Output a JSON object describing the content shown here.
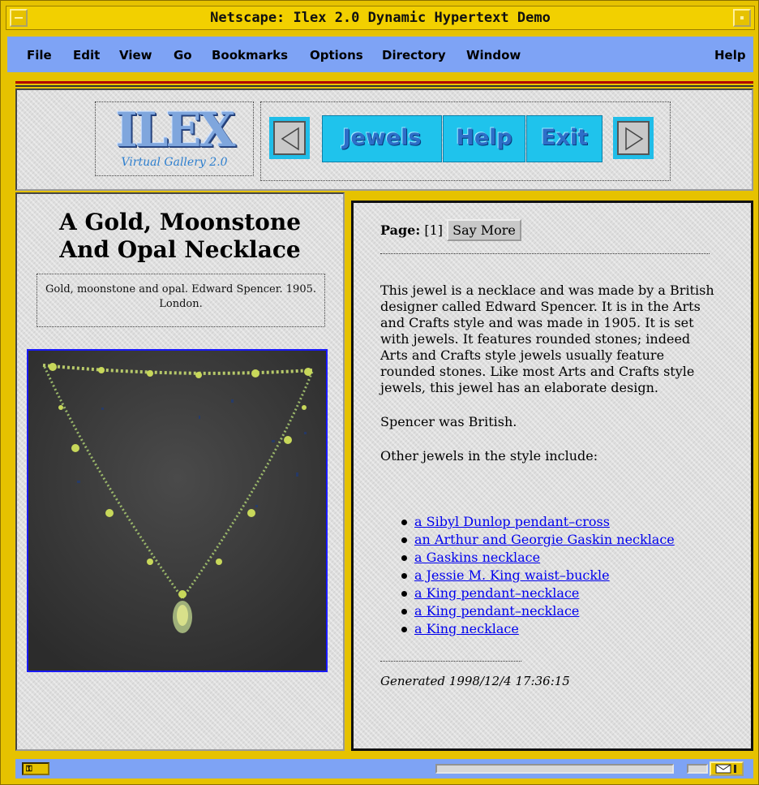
{
  "window": {
    "title": "Netscape: Ilex 2.0 Dynamic Hypertext Demo"
  },
  "menu": [
    "File",
    "Edit",
    "View",
    "Go",
    "Bookmarks",
    "Options",
    "Directory",
    "Window",
    "Help"
  ],
  "logo": {
    "title": "ILEX",
    "subtitle": "Virtual Gallery 2.0"
  },
  "nav": {
    "prev_icon": "left-arrow-icon",
    "next_icon": "right-arrow-icon",
    "jewels": "Jewels",
    "help": "Help",
    "exit": "Exit",
    "accent": "#1fc3ec"
  },
  "item": {
    "title_line1": "A Gold, Moonstone",
    "title_line2": "And Opal Necklace",
    "caption": "Gold, moonstone and opal. Edward Spencer. 1905. London."
  },
  "content": {
    "page_label": "Page:",
    "page_number": "[1]",
    "say_more": "Say More",
    "para1": "This jewel is a necklace and was made by a British designer called Edward Spencer. It is in the Arts and Crafts style and was made in 1905. It is set with jewels. It features rounded stones; indeed Arts and Crafts style jewels usually feature rounded stones. Like most Arts and Crafts style jewels, this jewel has an elaborate design.",
    "para2": "Spencer was British.",
    "para3": "Other jewels in the style include:",
    "links": [
      "a Sibyl Dunlop pendant–cross",
      "an Arthur and Georgie Gaskin necklace",
      "a Gaskins necklace",
      "a Jessie M. King waist–buckle",
      "a King pendant–necklace",
      "a King pendant–necklace",
      "a King necklace"
    ],
    "generated": "Generated 1998/12/4 17:36:15",
    "link_color": "#0000ee"
  },
  "status": {
    "security_icon": "security-key-icon",
    "mail_icon": "mail-icon"
  }
}
